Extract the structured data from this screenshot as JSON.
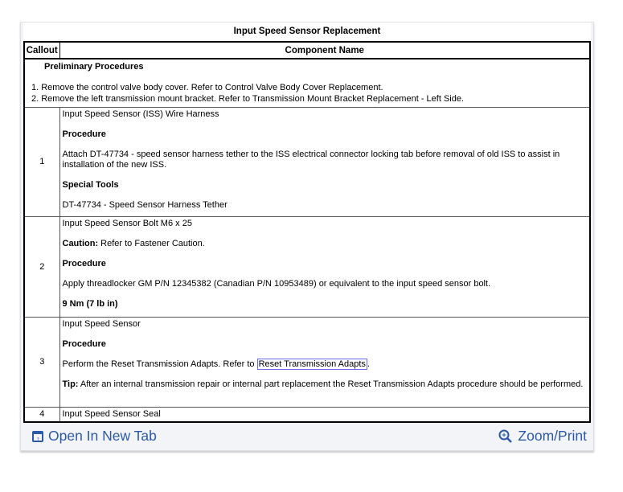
{
  "title": "Input Speed Sensor Replacement",
  "headers": {
    "callout": "Callout",
    "component": "Component Name"
  },
  "preliminary": {
    "heading": "Preliminary Procedures",
    "steps": [
      "1.  Remove the control valve body cover. Refer to Control Valve Body Cover Replacement.",
      "2.  Remove the left transmission mount bracket. Refer to Transmission Mount Bracket Replacement - Left Side."
    ]
  },
  "rows": [
    {
      "callout": "1",
      "name": "Input Speed Sensor (ISS) Wire Harness",
      "procedure_label": "Procedure",
      "procedure": "Attach DT-47734 - speed sensor harness tether to the ISS electrical connector locking tab before removal of old ISS to assist in installation of the new ISS.",
      "tools_label": "Special Tools",
      "tools": "DT-47734 - Speed Sensor Harness Tether"
    },
    {
      "callout": "2",
      "name": "Input Speed Sensor Bolt M6 x 25",
      "caution_label": "Caution:",
      "caution": " Refer to Fastener Caution.",
      "procedure_label": "Procedure",
      "procedure": "Apply threadlocker GM P/N 12345382 (Canadian P/N 10953489) or equivalent to the input speed sensor bolt.",
      "torque": "9 Nm (7 lb in)"
    },
    {
      "callout": "3",
      "name": "Input Speed Sensor",
      "procedure_label": "Procedure",
      "procedure": "Perform the Reset Transmission Adapts. Refer to ",
      "link": "Reset Transmission Adapts",
      "tip_label": "Tip:",
      "tip": " After an internal transmission repair or internal part replacement the Reset Transmission Adapts procedure should be performed."
    },
    {
      "callout": "4",
      "name": "Input Speed Sensor Seal"
    }
  ],
  "footer": {
    "open_tab": "Open In New Tab",
    "zoom": "Zoom/Print"
  },
  "colors": {
    "link": "#2c5aa8"
  }
}
